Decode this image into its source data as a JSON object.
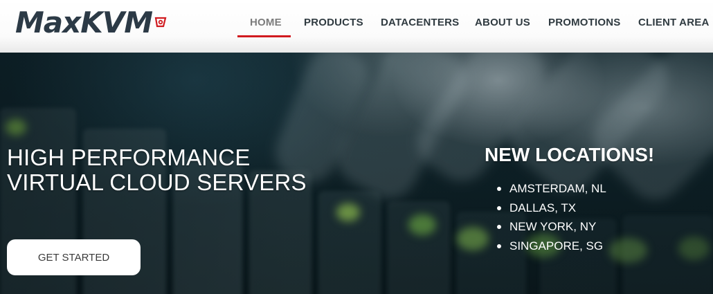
{
  "brand": {
    "name": "MaxKVM",
    "accent_color": "#d11a1f",
    "text_color": "#2c3a46"
  },
  "nav": {
    "items": [
      {
        "label": "HOME",
        "active": true
      },
      {
        "label": "PRODUCTS",
        "active": false
      },
      {
        "label": "DATACENTERS",
        "active": false
      },
      {
        "label": "ABOUT US",
        "active": false
      },
      {
        "label": "PROMOTIONS",
        "active": false
      },
      {
        "label": "CLIENT AREA",
        "active": false
      }
    ]
  },
  "hero": {
    "title_line1": "HIGH PERFORMANCE",
    "title_line2": "VIRTUAL CLOUD SERVERS",
    "cta_label": "GET STARTED",
    "background": "blurred-server-rack-photo"
  },
  "locations": {
    "title": "NEW LOCATIONS!",
    "items": [
      "AMSTERDAM, NL",
      "DALLAS, TX",
      "NEW YORK, NY",
      "SINGAPORE, SG"
    ]
  }
}
